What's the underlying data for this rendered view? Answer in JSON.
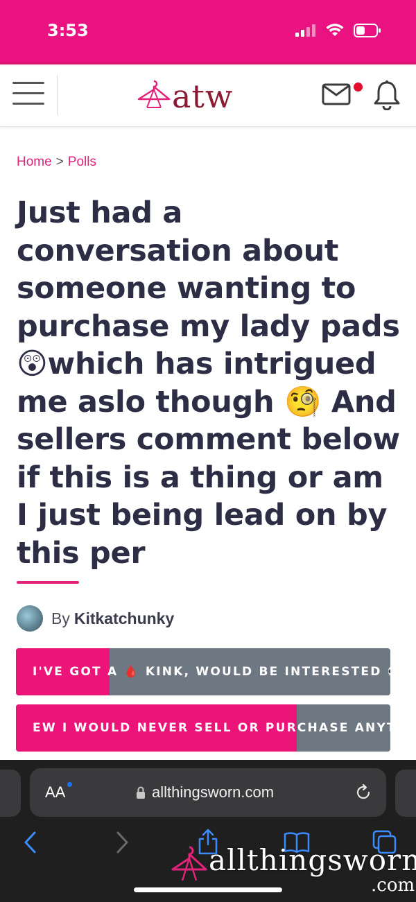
{
  "status_bar": {
    "time": "3:53"
  },
  "header": {
    "logo_text": "atw"
  },
  "breadcrumb": {
    "home": "Home",
    "separator": ">",
    "current": "Polls"
  },
  "post": {
    "title": "Just had a conversation about someone wanting to purchase my lady pads😲which has intrigued me aslo though 🧐 And sellers comment below if this is a thing or am I just being lead on by this per",
    "by_label": "By",
    "author": "Kitkatchunky"
  },
  "poll": {
    "options": [
      {
        "label": "I'VE GOT A 🩸 KINK, WOULD BE INTERESTED 👀 -",
        "fill_percent": 25
      },
      {
        "label": "EW I WOULD NEVER SELL OR PURCHASE ANYTHI",
        "fill_percent": 75
      }
    ]
  },
  "browser": {
    "aa_label": "AA",
    "url": "allthingsworn.com"
  },
  "watermark": {
    "name": "allthingsworn",
    "suffix": ".com"
  },
  "colors": {
    "brand_pink": "#ea1280",
    "logo_maroon": "#8b1a33",
    "poll_gray": "#6e7882"
  }
}
